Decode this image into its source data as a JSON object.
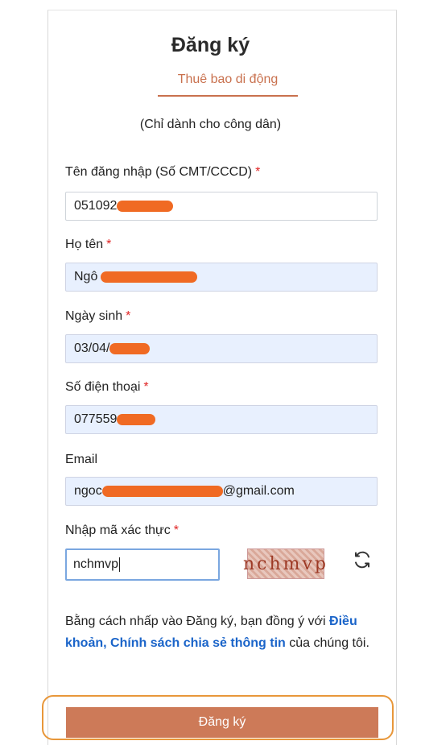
{
  "header": {
    "title": "Đăng ký",
    "tab_label": "Thuê bao di động",
    "subtitle": "(Chỉ dành cho công dân)"
  },
  "form": {
    "username": {
      "label": "Tên đăng nhập (Số CMT/CCCD)",
      "required_mark": "*",
      "value": "051092"
    },
    "fullname": {
      "label": "Họ tên",
      "required_mark": "*",
      "value": "Ngô"
    },
    "birthdate": {
      "label": "Ngày sinh",
      "required_mark": "*",
      "value": "03/04/"
    },
    "phone": {
      "label": "Số điện thoại",
      "required_mark": "*",
      "value": "077559"
    },
    "email": {
      "label": "Email",
      "value_prefix": "ngoc",
      "value_suffix": "@gmail.com"
    },
    "captcha": {
      "label": "Nhập mã xác thực",
      "required_mark": "*",
      "value": "nchmvp",
      "image_text": "nchmvp"
    }
  },
  "terms": {
    "text_before": "Bằng cách nhấp vào Đăng ký, bạn đồng ý với ",
    "link_text": "Điều khoản, Chính sách chia sẻ thông tin",
    "text_after": " của chúng tôi."
  },
  "submit_label": "Đăng ký",
  "colors": {
    "accent": "#cd7a58",
    "link": "#1a64c9",
    "required": "#e02424",
    "highlight": "#e8973a"
  },
  "icons": {
    "refresh": "refresh-icon"
  }
}
